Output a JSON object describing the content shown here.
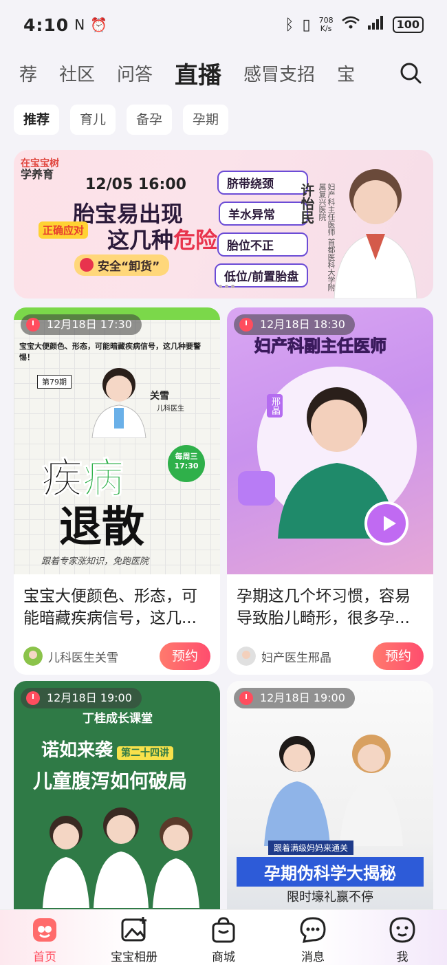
{
  "status_bar": {
    "time": "4:10",
    "net_speed_value": "708",
    "net_speed_unit": "K/s",
    "battery": "100"
  },
  "top_tabs": [
    {
      "label": "荐",
      "active": false
    },
    {
      "label": "社区",
      "active": false
    },
    {
      "label": "问答",
      "active": false
    },
    {
      "label": "直播",
      "active": true
    },
    {
      "label": "感冒支招",
      "active": false
    },
    {
      "label": "宝",
      "active": false
    }
  ],
  "sub_tabs": [
    {
      "label": "推荐",
      "active": true
    },
    {
      "label": "育儿",
      "active": false
    },
    {
      "label": "备孕",
      "active": false
    },
    {
      "label": "孕期",
      "active": false
    }
  ],
  "banner": {
    "logo_line1": "在宝宝树",
    "logo_line2": "学养育",
    "datetime": "12/05 16:00",
    "headline_line1": "胎宝易出现",
    "headline_line2": "这几种",
    "headline_danger": "危险",
    "badge": "正确应对",
    "safe_label": "安全“卸货”",
    "topics": [
      "脐带绕颈",
      "羊水异常",
      "胎位不正",
      "低位/前置胎盘"
    ],
    "doctor_name": "许怡民",
    "doctor_title": "妇产科主任医师 首都医科大学附属复兴医院"
  },
  "cards": [
    {
      "time": "12月18日 17:30",
      "title": "宝宝大便颜色、形态，可能暗藏疾病信号，这几...",
      "author": "儿科医生关雪",
      "action": "预约",
      "thumb": {
        "caption": "宝宝大便颜色、形态，可能暗藏疾病信号，这几种要警惕！",
        "issue": "第79期",
        "doctor": "关雪",
        "doctor_role": "儿科医生",
        "big_line1_a": "疾",
        "big_line1_b": "病",
        "big_line2": "退散",
        "schedule": "每周三 17:30",
        "sign": "跟着专家涨知识，免跑医院"
      }
    },
    {
      "time": "12月18日 18:30",
      "title": "孕期这几个坏习惯，容易导致胎儿畸形，很多孕...",
      "author": "妇产医生邢晶",
      "action": "预约",
      "thumb": {
        "headline": "妇产科副主任医师",
        "doctor": "邢晶"
      }
    },
    {
      "time": "12月18日 19:00",
      "thumb": {
        "line1": "丁桂成长课堂",
        "line2": "诺如来袭",
        "tag": "第二十四讲",
        "line3": "儿童腹泻如何破局"
      }
    },
    {
      "time": "12月18日 19:00",
      "thumb": {
        "ribbon": "跟着满级妈妈来通关",
        "headline": "孕期伪科学大揭秘",
        "sub": "限时壕礼赢不停"
      }
    }
  ],
  "bottom_nav": [
    {
      "label": "首页",
      "icon": "home-icon",
      "active": true
    },
    {
      "label": "宝宝相册",
      "icon": "album-icon",
      "active": false
    },
    {
      "label": "商城",
      "icon": "shop-bag-icon",
      "active": false
    },
    {
      "label": "消息",
      "icon": "message-icon",
      "active": false
    },
    {
      "label": "我",
      "icon": "profile-icon",
      "active": false
    }
  ],
  "colors": {
    "accent": "#ff4d5e",
    "background": "#f4f3f8"
  }
}
